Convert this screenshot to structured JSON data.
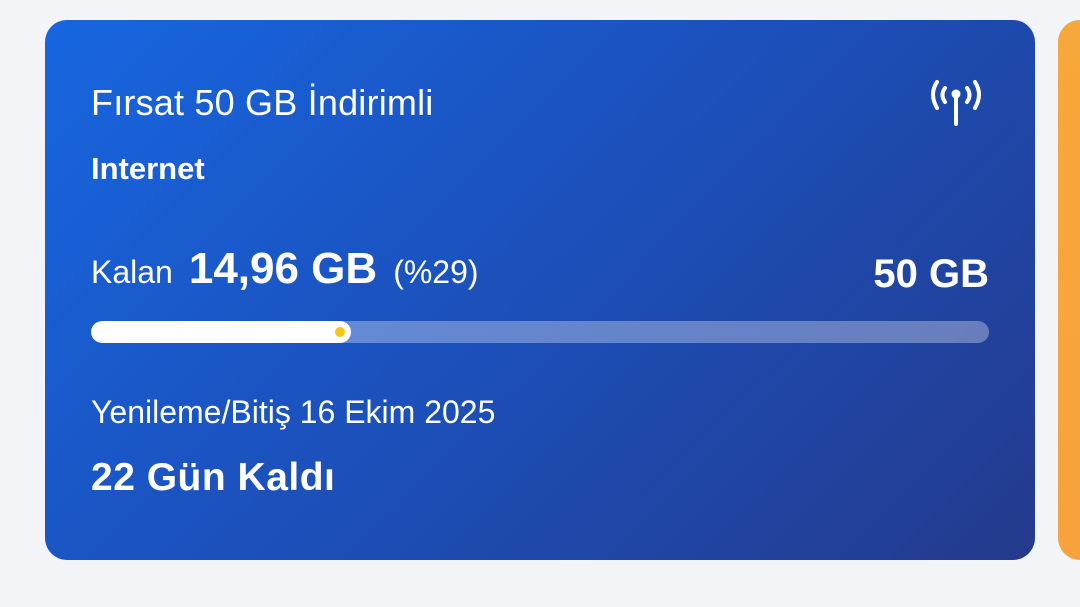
{
  "card": {
    "title": "Fırsat 50 GB İndirimli",
    "type": "Internet",
    "icon": "signal-antenna-icon",
    "remaining_label": "Kalan",
    "remaining_value": "14,96 GB",
    "remaining_percent": "(%29)",
    "usage_fraction": 0.29,
    "total_value": "50 GB",
    "renewal_label": "Yenileme/Bitiş",
    "renewal_date": "16 Ekim 2025",
    "days_left": "22 Gün Kaldı"
  },
  "colors": {
    "card_gradient_start": "#1766e0",
    "card_gradient_end": "#243a8c",
    "next_card": "#f7a83a",
    "progress_dot": "#f5c518",
    "page_background": "#f3f4f8"
  }
}
